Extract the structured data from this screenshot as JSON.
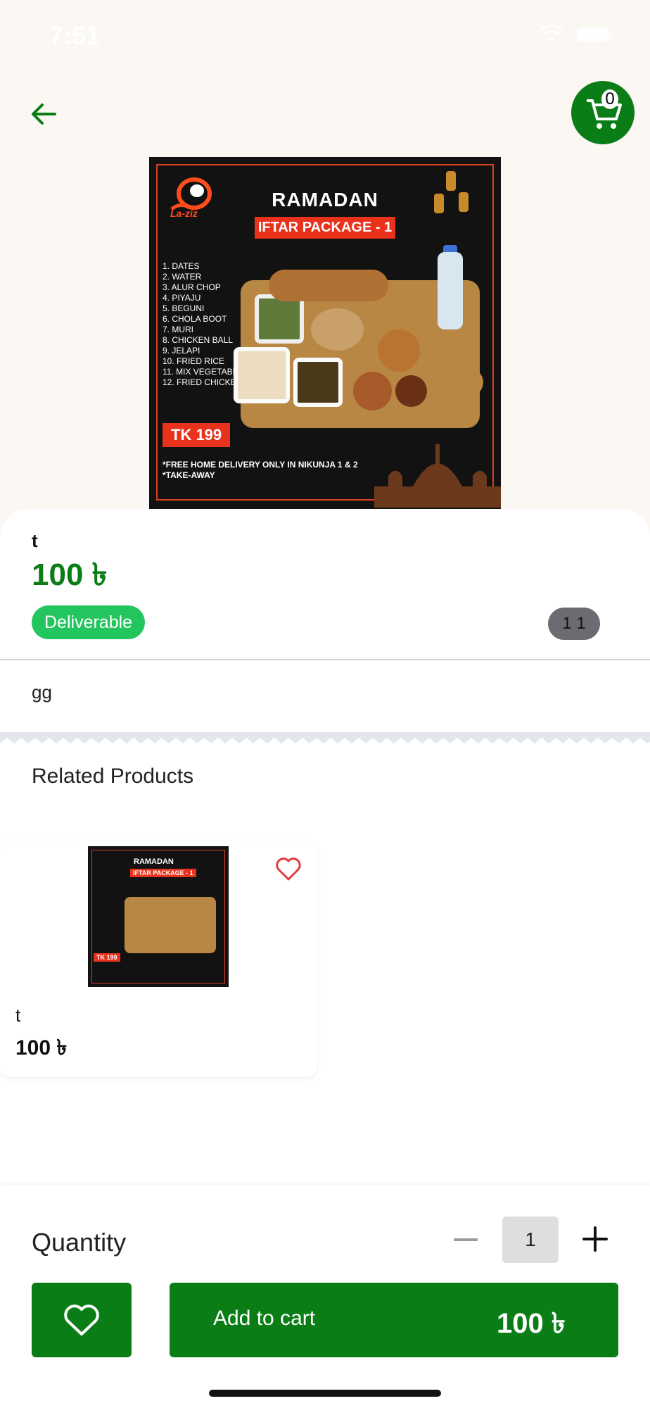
{
  "status_bar": {
    "time": "7:51"
  },
  "header": {
    "back_icon": "arrow-left-icon",
    "cart_icon": "cart-icon",
    "cart_count": "0"
  },
  "hero_image": {
    "brand": "La-ziz",
    "title": "RAMADAN",
    "subtitle": "IFTAR PACKAGE - 1",
    "menu_items": [
      "1. DATES",
      "2. WATER",
      "3. ALUR CHOP",
      "4. PIYAJU",
      "5. BEGUNI",
      "6. CHOLA BOOT",
      "7. MURI",
      "8. CHICKEN BALL",
      "9. JELAPI",
      "10. FRIED RICE",
      "11. MIX VEGETABLE",
      "12. FRIED CHICKEN"
    ],
    "price_tag": "TK 199",
    "note_1": "*FREE HOME DELIVERY ONLY IN NIKUNJA 1 & 2",
    "note_2": "*TAKE-AWAY"
  },
  "product": {
    "name": "t",
    "price": "100 ৳",
    "badge": "Deliverable",
    "stock": "1 1",
    "description": "gg"
  },
  "related": {
    "title": "Related Products",
    "items": [
      {
        "name": "t",
        "price": "100 ৳",
        "thumb_title": "RAMADAN",
        "thumb_subtitle": "IFTAR PACKAGE - 1",
        "thumb_price": "TK 199"
      }
    ]
  },
  "bottom_bar": {
    "quantity_label": "Quantity",
    "quantity_value": "1",
    "add_to_cart_label": "Add to cart",
    "total_price": "100 ৳"
  },
  "colors": {
    "primary_green": "#0a7d16",
    "badge_green": "#22c55e",
    "promo_red": "#e8321c"
  }
}
